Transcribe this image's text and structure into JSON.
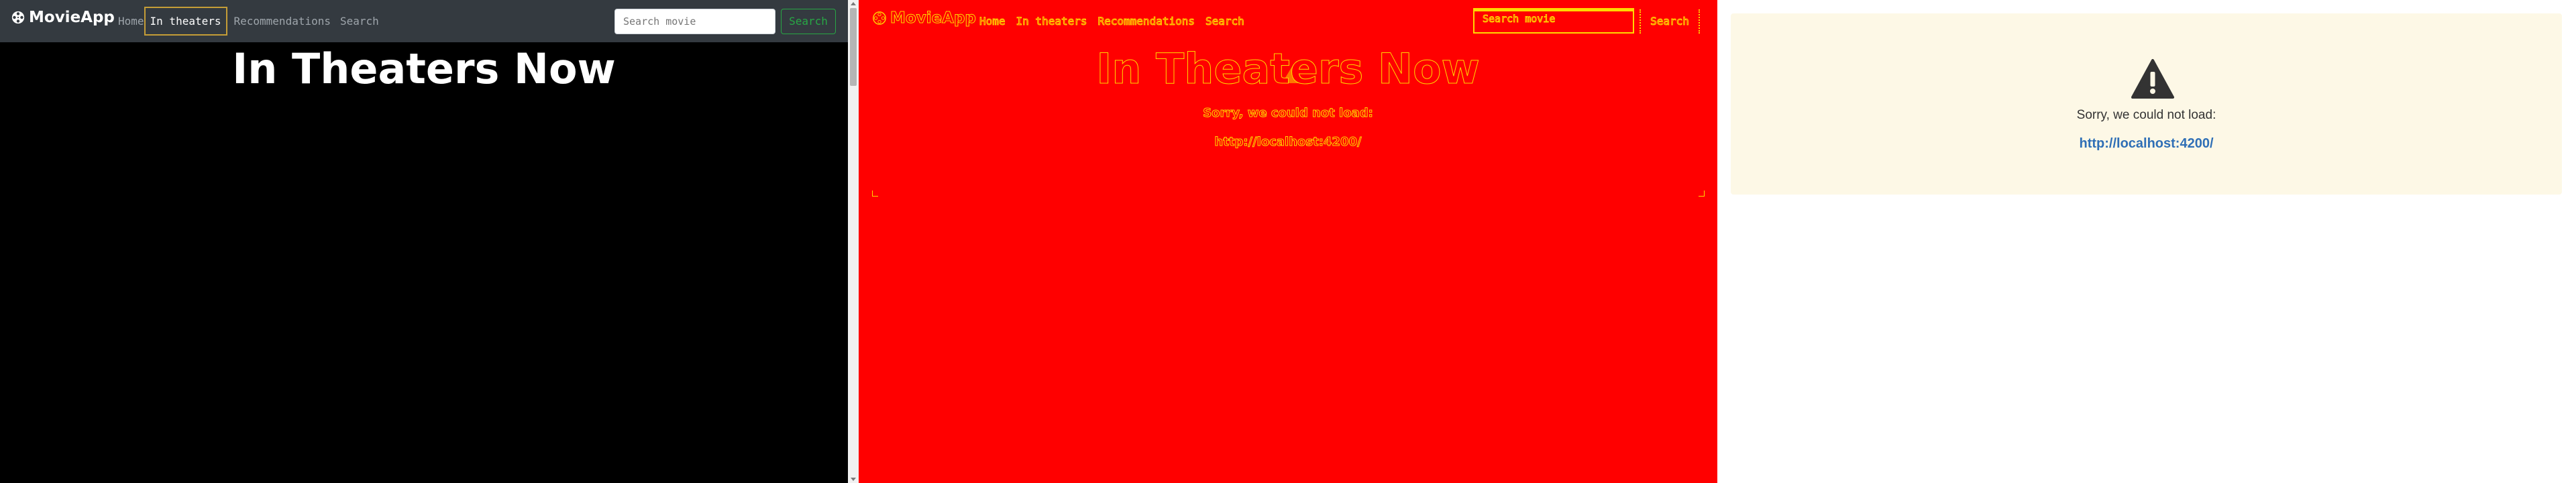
{
  "app": {
    "brand": "MovieApp",
    "nav": {
      "home": "Home",
      "in_theaters": "In theaters",
      "recommendations": "Recommendations",
      "search": "Search"
    },
    "search_placeholder": "Search movie",
    "search_button": "Search",
    "page_title": "In Theaters Now",
    "colors": {
      "navbar": "#343a40",
      "active_border": "#c59d37",
      "search_button": "#28a745",
      "background": "#000000"
    }
  },
  "error": {
    "message": "Sorry, we could not load:",
    "url": "http://localhost:4200/",
    "icon": "warning-icon",
    "colors": {
      "card": "#fdf8e6",
      "link": "#2f6fb6"
    }
  },
  "diff": {
    "colors": {
      "background": "#ff0000",
      "outline": "#ffd900"
    }
  }
}
